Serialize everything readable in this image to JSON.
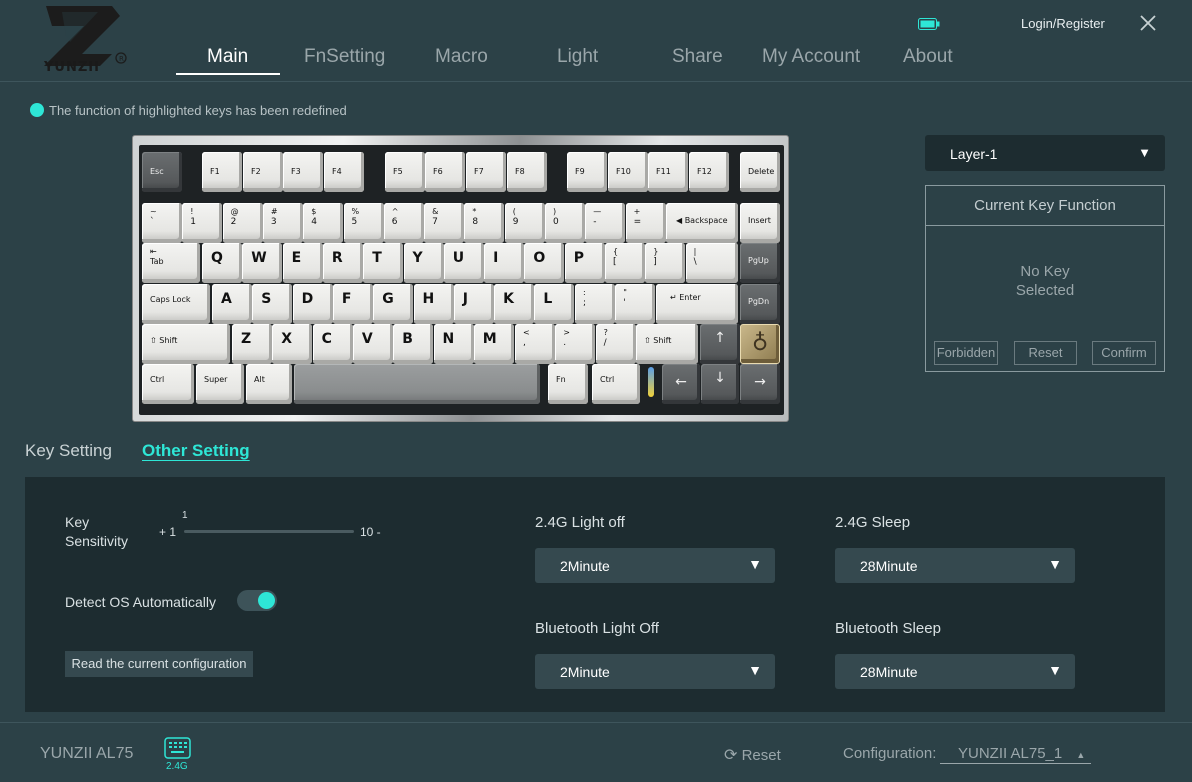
{
  "brand": {
    "logo_text": "YUNZII"
  },
  "nav": {
    "items": [
      {
        "label": "Main"
      },
      {
        "label": "FnSetting"
      },
      {
        "label": "Macro"
      },
      {
        "label": "Light"
      },
      {
        "label": "Share"
      },
      {
        "label": "My Account"
      },
      {
        "label": "About"
      }
    ],
    "active": "Main"
  },
  "header": {
    "login_label": "Login/Register",
    "battery_icon": "battery-icon",
    "close_icon": "close-icon"
  },
  "info": {
    "highlight_note": "The function of highlighted keys has been redefined",
    "accent": "#2ee6d6"
  },
  "keyboard": {
    "row0": [
      "Esc",
      "F1",
      "F2",
      "F3",
      "F4",
      "F5",
      "F6",
      "F7",
      "F8",
      "F9",
      "F10",
      "F11",
      "F12",
      "Delete"
    ],
    "row1": [
      {
        "t": "~",
        "b": "`"
      },
      {
        "t": "!",
        "b": "1"
      },
      {
        "t": "@",
        "b": "2"
      },
      {
        "t": "#",
        "b": "3"
      },
      {
        "t": "$",
        "b": "4"
      },
      {
        "t": "%",
        "b": "5"
      },
      {
        "t": "^",
        "b": "6"
      },
      {
        "t": "&",
        "b": "7"
      },
      {
        "t": "*",
        "b": "8"
      },
      {
        "t": "(",
        "b": "9"
      },
      {
        "t": ")",
        "b": "0"
      },
      {
        "t": "—",
        "b": "-"
      },
      {
        "t": "+",
        "b": "="
      }
    ],
    "backspace": "Backspace",
    "insert": "Insert",
    "tab": "Tab",
    "row2": [
      "Q",
      "W",
      "E",
      "R",
      "T",
      "Y",
      "U",
      "I",
      "O",
      "P"
    ],
    "row2_sym": [
      {
        "t": "{",
        "b": "["
      },
      {
        "t": "}",
        "b": "]"
      },
      {
        "t": "|",
        "b": "\\"
      }
    ],
    "pgup": "PgUp",
    "capslock": "Caps Lock",
    "row3": [
      "A",
      "S",
      "D",
      "F",
      "G",
      "H",
      "J",
      "K",
      "L"
    ],
    "row3_sym": [
      {
        "t": ":",
        "b": ";"
      },
      {
        "t": "\"",
        "b": "'"
      }
    ],
    "enter": "Enter",
    "pgdn": "PgDn",
    "shift": "Shift",
    "row4": [
      "Z",
      "X",
      "C",
      "V",
      "B",
      "N",
      "M"
    ],
    "row4_sym": [
      {
        "t": "<",
        "b": ","
      },
      {
        "t": ">",
        "b": "."
      },
      {
        "t": "?",
        "b": "/"
      }
    ],
    "rshift": "Shift",
    "up": "↑",
    "row5": {
      "ctrl": "Ctrl",
      "super": "Super",
      "alt": "Alt",
      "fn": "Fn",
      "rctrl": "Ctrl",
      "left": "←",
      "down": "↓",
      "right": "→"
    }
  },
  "layer": {
    "selected": "Layer-1"
  },
  "current_key": {
    "title": "Current Key Function",
    "no_key_line1": "No Key",
    "no_key_line2": "Selected",
    "buttons": {
      "forbidden": "Forbidden",
      "reset": "Reset",
      "confirm": "Confirm"
    }
  },
  "tabs": {
    "key_setting": "Key Setting",
    "other_setting": "Other Setting",
    "active": "Other Setting"
  },
  "settings": {
    "key_sensitivity_line1": "Key",
    "key_sensitivity_line2": "Sensitivity",
    "slider_value": "1",
    "slider_min_label": "+ 1",
    "slider_max_label": "10 -",
    "detect_os_label": "Detect OS Automatically",
    "detect_os_on": true,
    "read_config_label": "Read the current configuration",
    "light_off_24g_label": "2.4G Light off",
    "light_off_24g_value": "2Minute",
    "sleep_24g_label": "2.4G Sleep",
    "sleep_24g_value": "28Minute",
    "bt_light_off_label": "Bluetooth Light Off",
    "bt_light_off_value": "2Minute",
    "bt_sleep_label": "Bluetooth Sleep",
    "bt_sleep_value": "28Minute"
  },
  "footer": {
    "device_name": "YUNZII AL75",
    "connection_label": "2.4G",
    "reset_label": "Reset",
    "config_label": "Configuration:",
    "config_value": "YUNZII AL75_1"
  }
}
